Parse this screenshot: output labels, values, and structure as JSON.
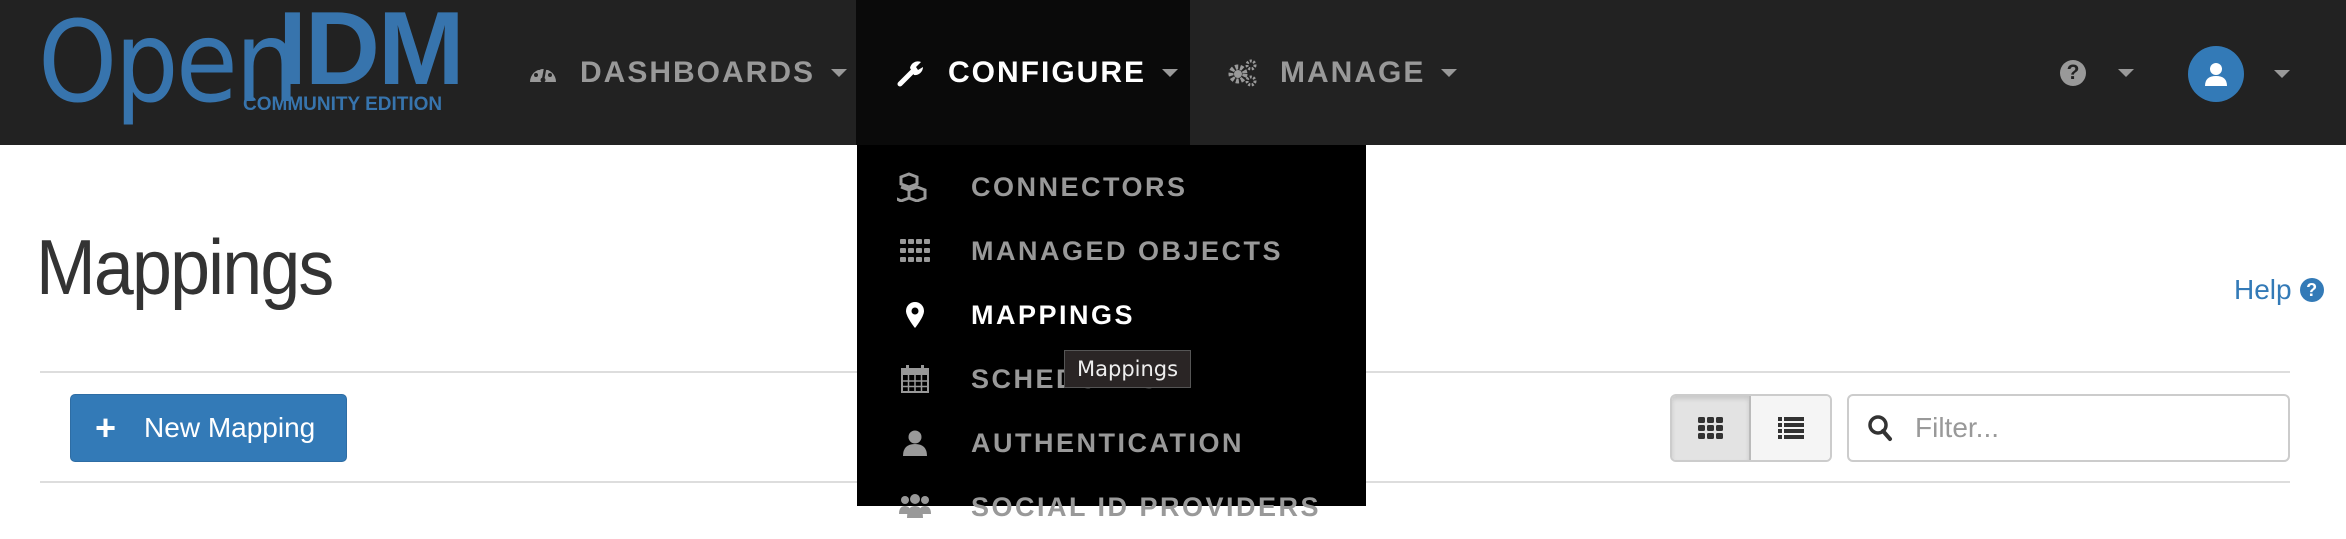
{
  "navbar": {
    "logo": {
      "open": "Open",
      "idm": "IDM",
      "edition": "COMMUNITY EDITION"
    },
    "items": [
      {
        "label": "DASHBOARDS",
        "icon": "dashboard-gauge-icon",
        "active": false
      },
      {
        "label": "CONFIGURE",
        "icon": "wrench-icon",
        "active": true
      },
      {
        "label": "MANAGE",
        "icon": "cogs-icon",
        "active": false
      }
    ],
    "help_icon_glyph": "?",
    "user_icon": "user-icon"
  },
  "configure_menu": {
    "items": [
      {
        "label": "CONNECTORS",
        "icon": "cubes-icon"
      },
      {
        "label": "MANAGED OBJECTS",
        "icon": "grid-icon"
      },
      {
        "label": "MAPPINGS",
        "icon": "map-marker-icon",
        "active": true
      },
      {
        "label": "SCHEDULES",
        "icon": "calendar-icon"
      },
      {
        "label": "AUTHENTICATION",
        "icon": "user-icon"
      },
      {
        "label": "SOCIAL ID PROVIDERS",
        "icon": "users-icon"
      }
    ]
  },
  "tooltip": {
    "text": "Mappings"
  },
  "page": {
    "title": "Mappings",
    "help_label": "Help",
    "help_glyph": "?",
    "new_button": {
      "plus": "+",
      "label": "New Mapping"
    },
    "view_toggle": {
      "selected": "grid",
      "options": [
        "grid",
        "list"
      ]
    },
    "filter": {
      "placeholder": "Filter...",
      "value": ""
    }
  },
  "colors": {
    "brand": "#3774ad",
    "primary": "#337ab7",
    "navbar": "#222222",
    "active_tab": "#0a0a0a",
    "dropdown": "#000000"
  }
}
